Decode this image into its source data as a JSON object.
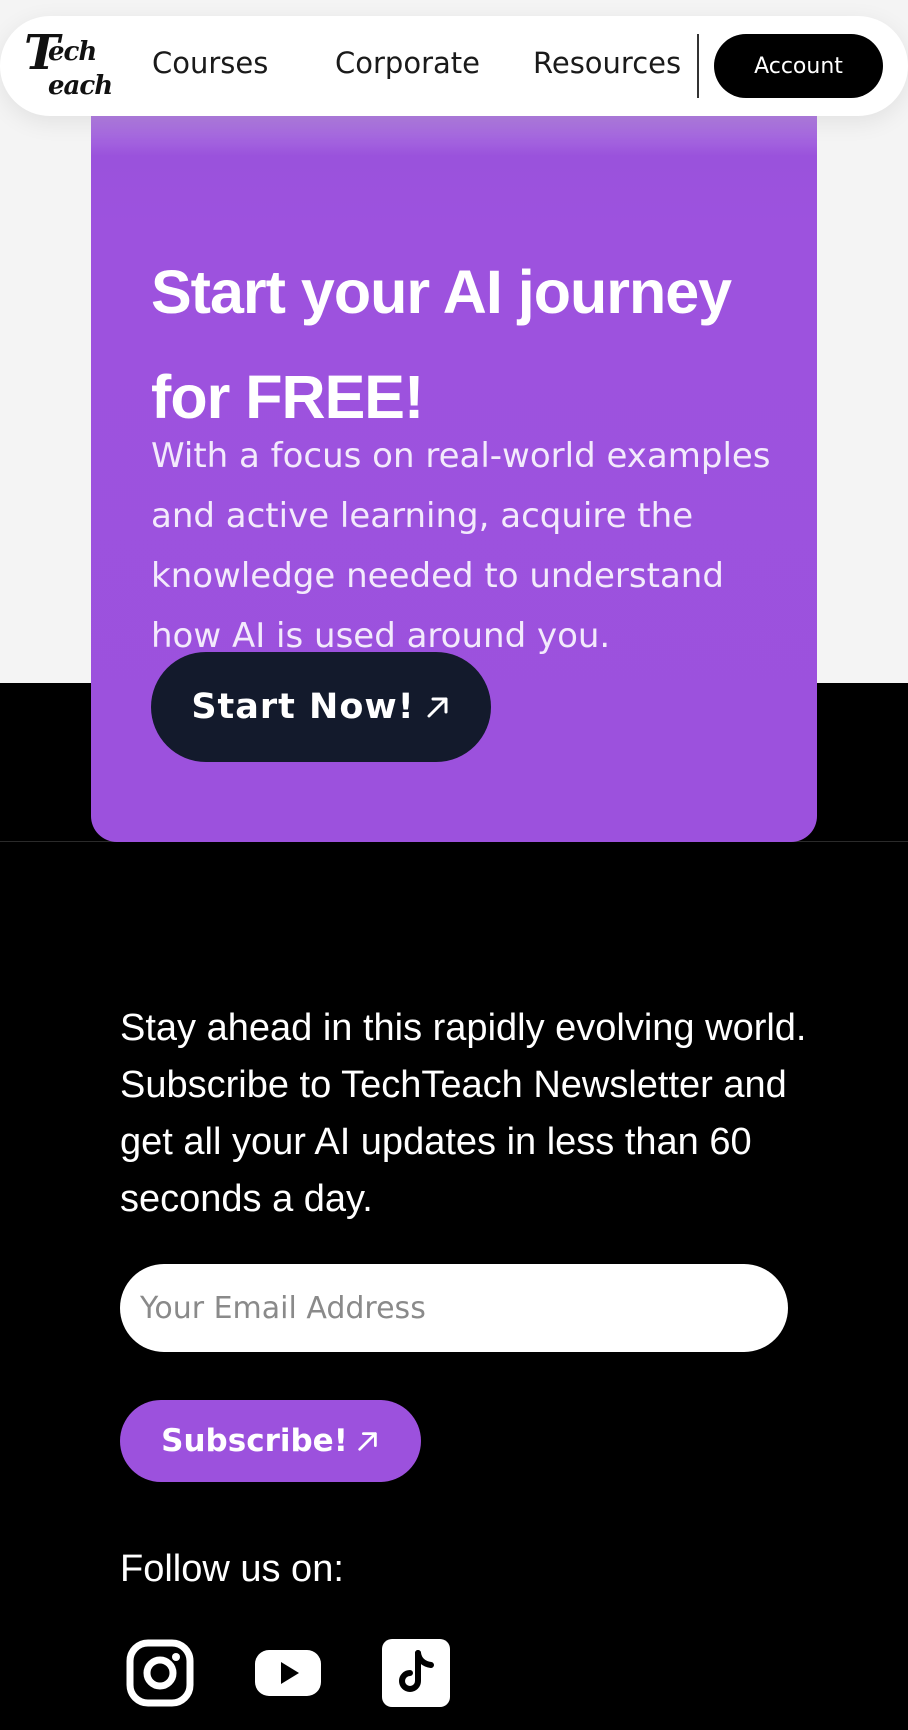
{
  "nav": {
    "logo_line1": "Tech",
    "logo_line2": "each",
    "logo_initial1": "T",
    "logo_initial2": "T",
    "links": [
      "Courses",
      "Corporate",
      "Resources"
    ],
    "account_label": "Account"
  },
  "hero": {
    "title": "Start your AI journey for FREE!",
    "body": "With a focus on real-world examples and active learning, acquire the knowledge needed to understand how AI is used around you.",
    "cta_label": "Start Now!",
    "cta_icon": "arrow-up-right-icon",
    "accent_color": "#9c51dd",
    "cta_color": "#131a2c"
  },
  "newsletter": {
    "text": "Stay ahead in this rapidly evolving world. Subscribe to TechTeach Newsletter and get all your AI updates in less than 60 seconds a day.",
    "email_placeholder": "Your Email Address",
    "subscribe_label": "Subscribe!",
    "subscribe_icon": "arrow-up-right-icon"
  },
  "follow": {
    "label": "Follow us on:",
    "icons": [
      "instagram-icon",
      "youtube-icon",
      "tiktok-icon"
    ]
  }
}
